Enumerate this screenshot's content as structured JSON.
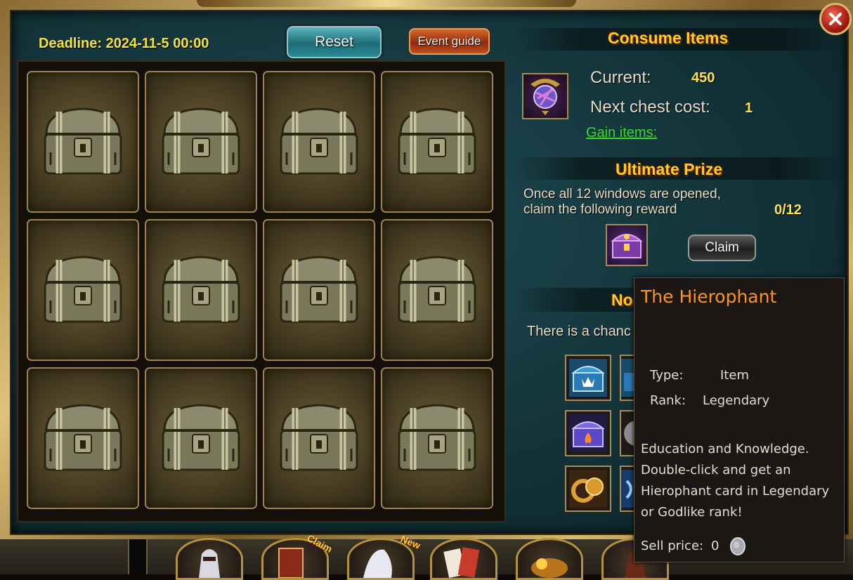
{
  "header": {
    "deadline": "Deadline: 2024-11-5 00:00",
    "reset_label": "Reset",
    "event_guide_label": "Event guide"
  },
  "chests": [
    {
      "icon": "chest-icon"
    },
    {
      "icon": "chest-icon"
    },
    {
      "icon": "chest-icon"
    },
    {
      "icon": "chest-icon"
    },
    {
      "icon": "chest-icon"
    },
    {
      "icon": "chest-icon"
    },
    {
      "icon": "chest-icon"
    },
    {
      "icon": "chest-icon"
    },
    {
      "icon": "chest-icon"
    },
    {
      "icon": "chest-icon"
    },
    {
      "icon": "chest-icon"
    },
    {
      "icon": "chest-icon"
    }
  ],
  "consume": {
    "title": "Consume Items",
    "current_label": "Current:",
    "current_value": "450",
    "next_cost_label": "Next chest cost:",
    "next_cost_value": "1",
    "gain_items_label": "Gain items:"
  },
  "ultimate": {
    "title": "Ultimate Prize",
    "description_line1": "Once all 12 windows are opened,",
    "description_line2": "claim the following reward",
    "progress": "0/12",
    "claim_label": "Claim"
  },
  "normal": {
    "title_partial": "No",
    "chance_text": "There is a chanc"
  },
  "tooltip": {
    "title": "The Hierophant",
    "type_label": "Type:",
    "type_value": "Item",
    "rank_label": "Rank:",
    "rank_value": "Legendary",
    "desc_line1": "Education and Knowledge.",
    "desc_line2": "Double-click and get an",
    "desc_line3": "Hierophant card in Legendary",
    "desc_line4": "or Godlike rank!",
    "sell_label": "Sell price:",
    "sell_value": "0"
  },
  "bottom": {
    "claim_tag": "Claim",
    "new_tag": "New"
  },
  "colors": {
    "deadline": "#f5e23a",
    "section_title": "#ffcc22",
    "gain_link": "#38d62e",
    "tooltip_title": "#ff9418",
    "value_yellow": "#ffe34a"
  }
}
